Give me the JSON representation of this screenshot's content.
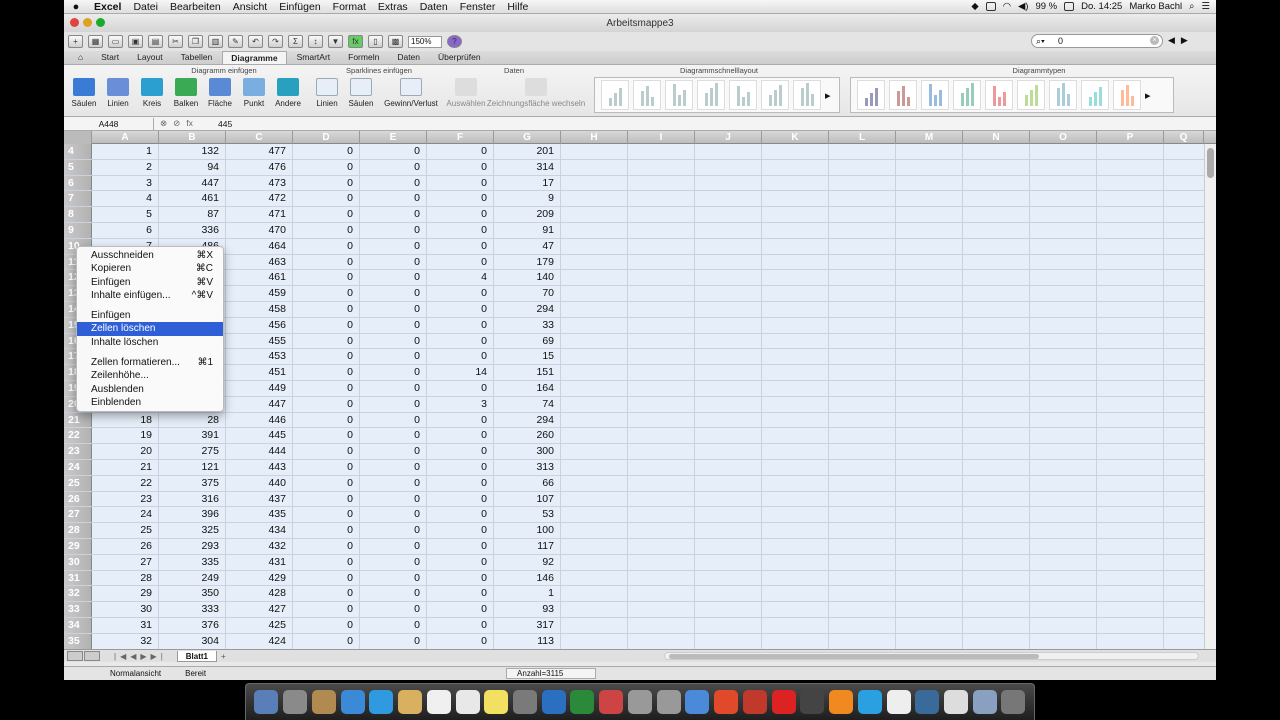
{
  "menubar": {
    "app": "Excel",
    "items": [
      "Datei",
      "Bearbeiten",
      "Ansicht",
      "Einfügen",
      "Format",
      "Extras",
      "Daten",
      "Fenster",
      "Hilfe"
    ],
    "battery": "99 %",
    "clock": "Do. 14:25",
    "user": "Marko Bachl"
  },
  "window": {
    "title": "Arbeitsmappe3"
  },
  "toolbar": {
    "zoom": "150%",
    "search_value": "0"
  },
  "ribbon": {
    "tabs": [
      "Start",
      "Layout",
      "Tabellen",
      "Diagramme",
      "SmartArt",
      "Formeln",
      "Daten",
      "Überprüfen"
    ],
    "active_tab": "Diagramme",
    "group_insert_title": "Diagramm einfügen",
    "group_sparklines_title": "Sparklines einfügen",
    "group_data_title": "Daten",
    "group_quicklayout_title": "Diagrammschnelllayout",
    "group_types_title": "Diagrammtypen",
    "chart_buttons": [
      "Säulen",
      "Linien",
      "Kreis",
      "Balken",
      "Fläche",
      "Punkt",
      "Andere"
    ],
    "sparkline_buttons": [
      "Linien",
      "Säulen",
      "Gewinn/Verlust"
    ],
    "data_buttons": [
      "Auswählen",
      "Zeichnungsfläche wechseln"
    ]
  },
  "formula_bar": {
    "name_box": "A448",
    "fx": "fx",
    "value": "445"
  },
  "columns": [
    "A",
    "B",
    "C",
    "D",
    "E",
    "F",
    "G",
    "H",
    "I",
    "J",
    "K",
    "L",
    "M",
    "N",
    "O",
    "P",
    "Q"
  ],
  "rows": [
    {
      "n": "4",
      "v": [
        "1",
        "132",
        "477",
        "0",
        "0",
        "0",
        "201"
      ]
    },
    {
      "n": "5",
      "v": [
        "2",
        "94",
        "476",
        "0",
        "0",
        "0",
        "314"
      ]
    },
    {
      "n": "6",
      "v": [
        "3",
        "447",
        "473",
        "0",
        "0",
        "0",
        "17"
      ]
    },
    {
      "n": "7",
      "v": [
        "4",
        "461",
        "472",
        "0",
        "0",
        "0",
        "9"
      ]
    },
    {
      "n": "8",
      "v": [
        "5",
        "87",
        "471",
        "0",
        "0",
        "0",
        "209"
      ]
    },
    {
      "n": "9",
      "v": [
        "6",
        "336",
        "470",
        "0",
        "0",
        "0",
        "91"
      ]
    },
    {
      "n": "10",
      "v": [
        "7",
        "486",
        "464",
        "0",
        "0",
        "0",
        "47"
      ]
    },
    {
      "n": "11",
      "v": [
        "",
        "",
        "463",
        "0",
        "0",
        "0",
        "179"
      ]
    },
    {
      "n": "12",
      "v": [
        "",
        "",
        "461",
        "0",
        "0",
        "4",
        "140"
      ]
    },
    {
      "n": "13",
      "v": [
        "",
        "",
        "459",
        "0",
        "0",
        "0",
        "70"
      ]
    },
    {
      "n": "14",
      "v": [
        "",
        "",
        "458",
        "0",
        "0",
        "0",
        "294"
      ]
    },
    {
      "n": "15",
      "v": [
        "",
        "",
        "456",
        "0",
        "0",
        "0",
        "33"
      ]
    },
    {
      "n": "16",
      "v": [
        "",
        "",
        "455",
        "0",
        "0",
        "0",
        "69"
      ]
    },
    {
      "n": "17",
      "v": [
        "",
        "",
        "453",
        "0",
        "0",
        "0",
        "15"
      ]
    },
    {
      "n": "18",
      "v": [
        "",
        "",
        "451",
        "0",
        "0",
        "14",
        "151"
      ]
    },
    {
      "n": "19",
      "v": [
        "",
        "",
        "449",
        "0",
        "0",
        "0",
        "164"
      ]
    },
    {
      "n": "20",
      "v": [
        "",
        "",
        "447",
        "0",
        "0",
        "3",
        "74"
      ]
    },
    {
      "n": "21",
      "v": [
        "18",
        "28",
        "446",
        "0",
        "0",
        "0",
        "294"
      ]
    },
    {
      "n": "22",
      "v": [
        "19",
        "391",
        "445",
        "0",
        "0",
        "0",
        "260"
      ]
    },
    {
      "n": "23",
      "v": [
        "20",
        "275",
        "444",
        "0",
        "0",
        "0",
        "300"
      ]
    },
    {
      "n": "24",
      "v": [
        "21",
        "121",
        "443",
        "0",
        "0",
        "0",
        "313"
      ]
    },
    {
      "n": "25",
      "v": [
        "22",
        "375",
        "440",
        "0",
        "0",
        "0",
        "66"
      ]
    },
    {
      "n": "26",
      "v": [
        "23",
        "316",
        "437",
        "0",
        "0",
        "0",
        "107"
      ]
    },
    {
      "n": "27",
      "v": [
        "24",
        "396",
        "435",
        "0",
        "0",
        "0",
        "53"
      ]
    },
    {
      "n": "28",
      "v": [
        "25",
        "325",
        "434",
        "0",
        "0",
        "0",
        "100"
      ]
    },
    {
      "n": "29",
      "v": [
        "26",
        "293",
        "432",
        "0",
        "0",
        "0",
        "117"
      ]
    },
    {
      "n": "30",
      "v": [
        "27",
        "335",
        "431",
        "0",
        "0",
        "0",
        "92"
      ]
    },
    {
      "n": "31",
      "v": [
        "28",
        "249",
        "429",
        "0",
        "0",
        "0",
        "146"
      ]
    },
    {
      "n": "32",
      "v": [
        "29",
        "350",
        "428",
        "0",
        "0",
        "0",
        "1"
      ]
    },
    {
      "n": "33",
      "v": [
        "30",
        "333",
        "427",
        "0",
        "0",
        "0",
        "93"
      ]
    },
    {
      "n": "34",
      "v": [
        "31",
        "376",
        "425",
        "0",
        "0",
        "0",
        "317"
      ]
    },
    {
      "n": "35",
      "v": [
        "32",
        "304",
        "424",
        "0",
        "0",
        "0",
        "113"
      ]
    }
  ],
  "context_menu": {
    "items": [
      {
        "label": "Ausschneiden",
        "shortcut": "⌘X"
      },
      {
        "label": "Kopieren",
        "shortcut": "⌘C"
      },
      {
        "label": "Einfügen",
        "shortcut": "⌘V"
      },
      {
        "label": "Inhalte einfügen...",
        "shortcut": "^⌘V"
      },
      {
        "sep": true
      },
      {
        "label": "Einfügen",
        "shortcut": ""
      },
      {
        "label": "Zellen löschen",
        "shortcut": "",
        "highlighted": true
      },
      {
        "label": "Inhalte löschen",
        "shortcut": ""
      },
      {
        "sep": true
      },
      {
        "label": "Zellen formatieren...",
        "shortcut": "⌘1"
      },
      {
        "label": "Zeilenhöhe...",
        "shortcut": ""
      },
      {
        "label": "Ausblenden",
        "shortcut": ""
      },
      {
        "label": "Einblenden",
        "shortcut": ""
      }
    ]
  },
  "sheet": {
    "tab": "Blatt1"
  },
  "status": {
    "view": "Normalansicht",
    "state": "Bereit",
    "sum": "Anzahl=3115"
  },
  "colors": {
    "accent": "#2f5fd6",
    "cell_bg": "#e5eef9",
    "header_bg": "#bdbdbd"
  }
}
